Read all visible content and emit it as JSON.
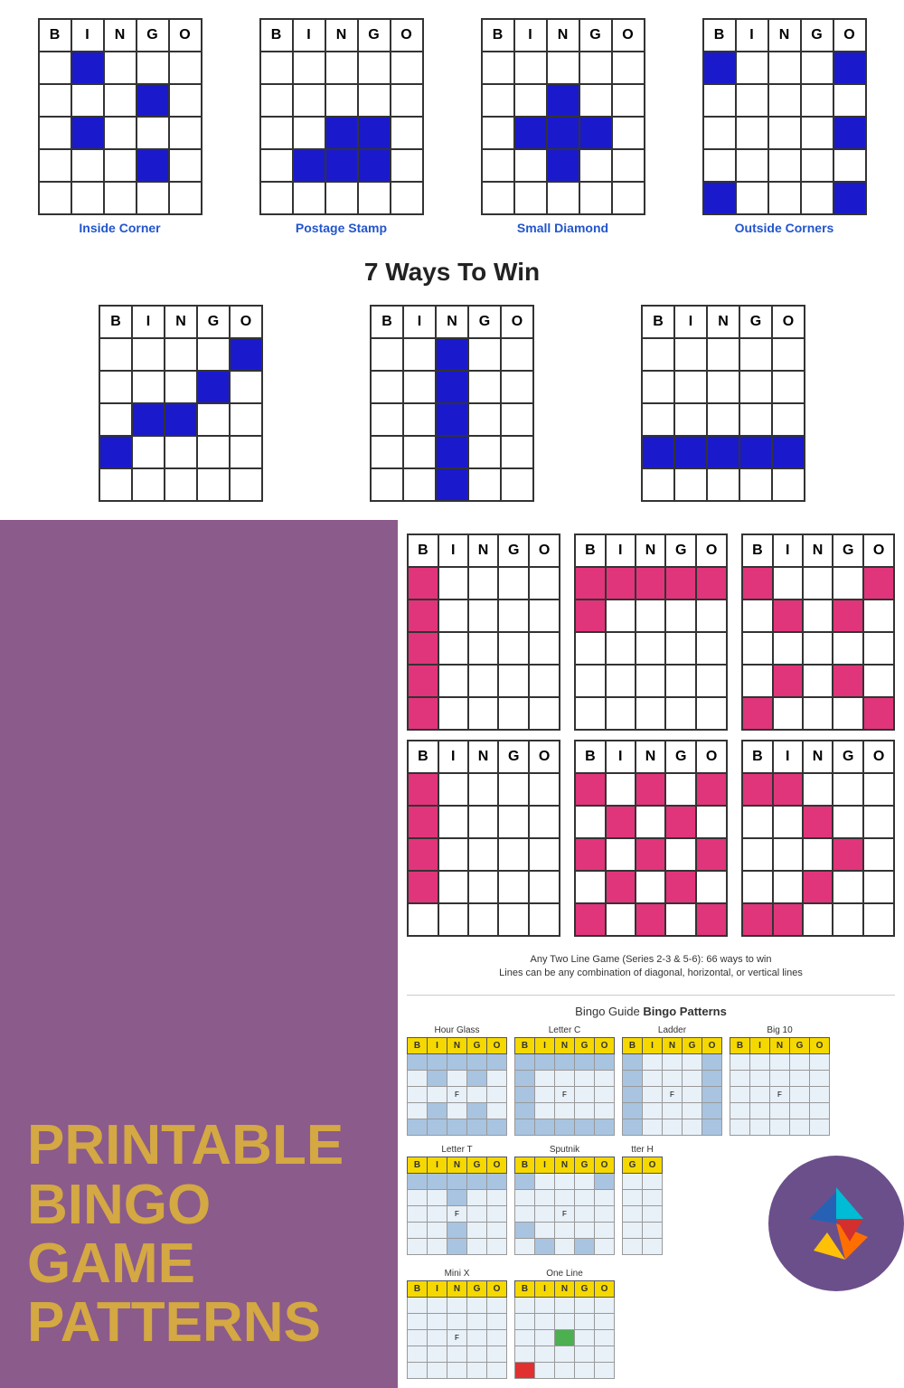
{
  "top": {
    "four_patterns": [
      {
        "label": "Inside Corner",
        "cells": [
          [
            false,
            true,
            false,
            false,
            false
          ],
          [
            false,
            false,
            false,
            true,
            false
          ],
          [
            false,
            true,
            false,
            false,
            false
          ],
          [
            false,
            false,
            false,
            true,
            false
          ],
          [
            false,
            false,
            false,
            false,
            false
          ]
        ]
      },
      {
        "label": "Postage Stamp",
        "cells": [
          [
            false,
            false,
            false,
            false,
            false
          ],
          [
            false,
            false,
            false,
            false,
            false
          ],
          [
            false,
            false,
            true,
            true,
            false
          ],
          [
            false,
            false,
            true,
            true,
            false
          ],
          [
            false,
            false,
            false,
            false,
            false
          ]
        ]
      },
      {
        "label": "Small Diamond",
        "cells": [
          [
            false,
            false,
            false,
            false,
            false
          ],
          [
            false,
            false,
            true,
            false,
            false
          ],
          [
            false,
            true,
            true,
            true,
            false
          ],
          [
            false,
            false,
            true,
            false,
            false
          ],
          [
            false,
            false,
            false,
            false,
            false
          ]
        ]
      },
      {
        "label": "Outside Corners",
        "cells": [
          [
            true,
            false,
            false,
            false,
            true
          ],
          [
            false,
            false,
            false,
            false,
            false
          ],
          [
            false,
            false,
            false,
            false,
            true
          ],
          [
            false,
            false,
            false,
            false,
            false
          ],
          [
            true,
            false,
            false,
            false,
            true
          ]
        ]
      }
    ],
    "ways_title": "7 Ways To Win",
    "three_patterns": [
      {
        "cells": [
          [
            false,
            false,
            false,
            false,
            true
          ],
          [
            false,
            false,
            false,
            true,
            false
          ],
          [
            false,
            true,
            true,
            false,
            false
          ],
          [
            true,
            false,
            false,
            false,
            false
          ],
          [
            false,
            false,
            false,
            false,
            false
          ]
        ]
      },
      {
        "cells": [
          [
            false,
            false,
            true,
            false,
            false
          ],
          [
            false,
            false,
            true,
            false,
            false
          ],
          [
            false,
            false,
            true,
            false,
            false
          ],
          [
            false,
            false,
            true,
            false,
            false
          ],
          [
            false,
            false,
            true,
            false,
            false
          ]
        ]
      },
      {
        "cells": [
          [
            false,
            false,
            false,
            false,
            false
          ],
          [
            false,
            false,
            false,
            false,
            false
          ],
          [
            false,
            false,
            false,
            false,
            false
          ],
          [
            true,
            true,
            true,
            true,
            true
          ],
          [
            false,
            false,
            false,
            false,
            false
          ]
        ]
      }
    ]
  },
  "left_panel": {
    "title_lines": [
      "PRINTABLE",
      "BINGO",
      "GAME",
      "PATTERNS"
    ]
  },
  "right_panel": {
    "pink_rows": [
      [
        {
          "cells": [
            [
              true,
              false,
              false,
              false,
              false
            ],
            [
              true,
              false,
              false,
              false,
              false
            ],
            [
              true,
              false,
              false,
              false,
              false
            ],
            [
              true,
              false,
              false,
              false,
              false
            ],
            [
              true,
              false,
              false,
              false,
              false
            ]
          ]
        },
        {
          "cells": [
            [
              true,
              true,
              true,
              true,
              true
            ],
            [
              true,
              false,
              false,
              false,
              false
            ],
            [
              false,
              false,
              false,
              false,
              false
            ],
            [
              false,
              false,
              false,
              false,
              false
            ],
            [
              false,
              false,
              false,
              false,
              false
            ]
          ]
        },
        {
          "cells": [
            [
              true,
              false,
              false,
              false,
              true
            ],
            [
              false,
              true,
              false,
              true,
              false
            ],
            [
              false,
              false,
              false,
              false,
              false
            ],
            [
              false,
              true,
              false,
              true,
              false
            ],
            [
              true,
              false,
              false,
              false,
              true
            ]
          ]
        }
      ],
      [
        {
          "cells": [
            [
              true,
              false,
              false,
              false,
              false
            ],
            [
              true,
              false,
              false,
              false,
              false
            ],
            [
              true,
              false,
              false,
              false,
              false
            ],
            [
              true,
              false,
              false,
              false,
              false
            ],
            [
              false,
              false,
              false,
              false,
              false
            ]
          ]
        },
        {
          "cells": [
            [
              true,
              false,
              true,
              false,
              true
            ],
            [
              false,
              true,
              false,
              true,
              false
            ],
            [
              true,
              false,
              true,
              false,
              true
            ],
            [
              false,
              true,
              false,
              true,
              false
            ],
            [
              true,
              false,
              true,
              false,
              true
            ]
          ]
        },
        {
          "cells": [
            [
              true,
              true,
              false,
              false,
              false
            ],
            [
              false,
              false,
              true,
              false,
              false
            ],
            [
              false,
              false,
              false,
              true,
              false
            ],
            [
              false,
              false,
              true,
              false,
              false
            ],
            [
              true,
              true,
              false,
              false,
              false
            ]
          ]
        }
      ]
    ],
    "any_two_line_text": "Any Two Line Game (Series 2-3 & 5-6): 66 ways to win",
    "any_two_line_text2": "Lines can be any combination of diagonal, horizontal, or vertical lines",
    "guide_title_plain": "Bingo Guide",
    "guide_title_bold": "Bingo Patterns",
    "guide_items_row1": [
      {
        "label": "Hour Glass"
      },
      {
        "label": "Letter C"
      },
      {
        "label": "Ladder"
      },
      {
        "label": "Big 10"
      }
    ],
    "guide_items_row2": [
      {
        "label": "Letter T"
      },
      {
        "label": "Sputnik"
      },
      {
        "label": "Letter H"
      }
    ],
    "guide_items_row3": [
      {
        "label": "Mini X"
      },
      {
        "label": "One Line"
      }
    ]
  }
}
